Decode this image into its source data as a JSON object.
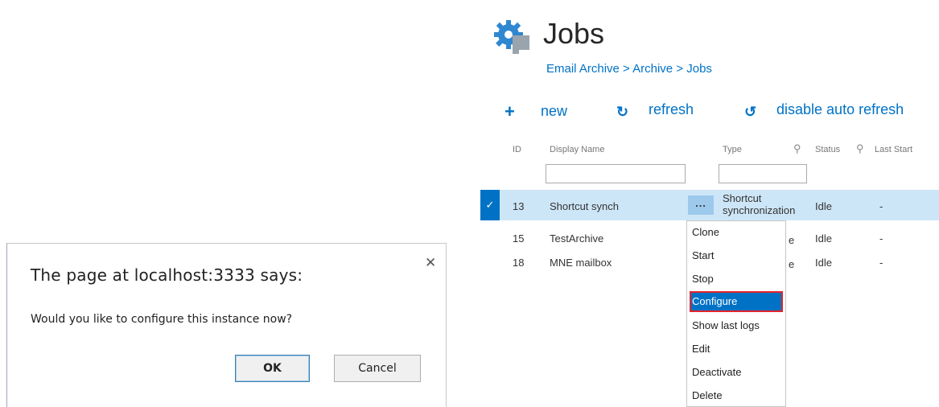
{
  "dialog": {
    "title": "The page at localhost:3333 says:",
    "message": "Would you like to configure this instance now?",
    "ok_label": "OK",
    "cancel_label": "Cancel",
    "close_glyph": "✕"
  },
  "page": {
    "title": "Jobs",
    "breadcrumb": "Email Archive > Archive > Jobs",
    "icon": "gear-icon"
  },
  "toolbar": {
    "new_label": "new",
    "refresh_label": "refresh",
    "auto_refresh_label": "disable auto refresh",
    "new_glyph": "+",
    "refresh_glyph": "↻",
    "auto_refresh_glyph": "↺"
  },
  "table": {
    "columns": [
      "ID",
      "Display Name",
      "Type",
      "Status",
      "Last Start"
    ],
    "rows": [
      {
        "id": "13",
        "name": "Shortcut synch",
        "type": "Shortcut synchronization",
        "status": "Idle",
        "last_start": "-"
      },
      {
        "id": "15",
        "name": "TestArchive",
        "type": "e",
        "status": "Idle",
        "last_start": "-"
      },
      {
        "id": "18",
        "name": "MNE mailbox",
        "type": "e",
        "status": "Idle",
        "last_start": "-"
      }
    ],
    "selected_row_check": "✓",
    "row_menu_glyph": "..."
  },
  "context_menu": {
    "items": [
      "Clone",
      "Start",
      "Stop",
      "Configure",
      "Show last logs",
      "Edit",
      "Deactivate",
      "Delete"
    ]
  },
  "colors": {
    "accent": "#0072c6",
    "selected_row": "#cde6f7",
    "highlight_border": "#e3242b"
  }
}
